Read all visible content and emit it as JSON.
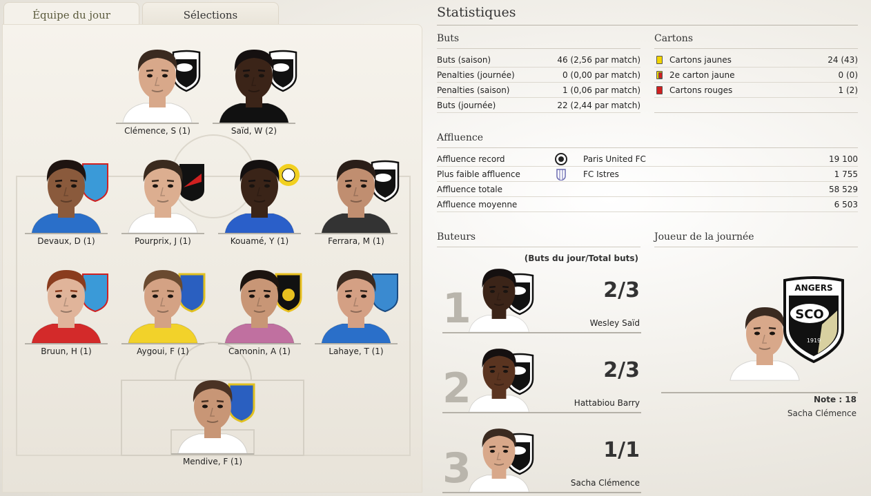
{
  "tabs": [
    {
      "label": "Équipe du jour",
      "active": true
    },
    {
      "label": "Sélections",
      "active": false
    }
  ],
  "team_of_day": {
    "players": [
      {
        "name": "Clémence, S (1)",
        "club": "SCO",
        "skin": "#d8a88a",
        "hair": "#3a2a20",
        "shirt": "#ffffff"
      },
      {
        "name": "Saïd, W (2)",
        "club": "SCO",
        "skin": "#3b2418",
        "hair": "#151010",
        "shirt": "#111111"
      },
      {
        "name": "Devaux, D (1)",
        "club": "VENDÉE",
        "skin": "#8a5a3c",
        "hair": "#1e1410",
        "shirt": "#2a6fc9"
      },
      {
        "name": "Pourprix, J (1)",
        "club": "RACING",
        "skin": "#dcae90",
        "hair": "#3a2a1e",
        "shirt": "#ffffff"
      },
      {
        "name": "Kouamé, Y (1)",
        "club": "SRC",
        "skin": "#3a2418",
        "hair": "#141010",
        "shirt": "#2a5fc9"
      },
      {
        "name": "Ferrara, M (1)",
        "club": "SCO",
        "skin": "#c08e70",
        "hair": "#2a1e18",
        "shirt": "#333333"
      },
      {
        "name": "Bruun, H (1)",
        "club": "VENDÉE",
        "skin": "#e0b49a",
        "hair": "#8a3c1e",
        "shirt": "#d32a2a"
      },
      {
        "name": "Aygoui, F (1)",
        "club": "UJ FC",
        "skin": "#d4a284",
        "hair": "#6a4a30",
        "shirt": "#f2d22a"
      },
      {
        "name": "Camonin, A (1)",
        "club": "TOUL",
        "skin": "#c89676",
        "hair": "#1c1410",
        "shirt": "#c070a0"
      },
      {
        "name": "Lahaye, T (1)",
        "club": "CHAMOIS",
        "skin": "#d4a084",
        "hair": "#3a2a20",
        "shirt": "#2a6fc9"
      },
      {
        "name": "Mendive, F (1)",
        "club": "UJ FC",
        "skin": "#c89676",
        "hair": "#4a3224",
        "shirt": "#ffffff"
      }
    ]
  },
  "stats": {
    "title": "Statistiques",
    "buts": {
      "title": "Buts",
      "rows": [
        {
          "label": "Buts (saison)",
          "value": "46 (2,56 par match)"
        },
        {
          "label": "Penalties (journée)",
          "value": "0 (0,00 par match)"
        },
        {
          "label": "Penalties (saison)",
          "value": "1 (0,06 par match)"
        },
        {
          "label": "Buts (journée)",
          "value": "22 (2,44 par match)"
        }
      ]
    },
    "cartons": {
      "title": "Cartons",
      "rows": [
        {
          "label": "Cartons jaunes",
          "value": "24 (43)",
          "color": "#f2d400"
        },
        {
          "label": "2e carton jaune",
          "value": "0 (0)",
          "color": "#f2d400"
        },
        {
          "label": "Cartons rouges",
          "value": "1 (2)",
          "color": "#d02020"
        }
      ]
    },
    "affluence": {
      "title": "Affluence",
      "rows": [
        {
          "label": "Affluence record",
          "club": "Paris United FC",
          "value": "19 100"
        },
        {
          "label": "Plus faible affluence",
          "club": "FC Istres",
          "value": "1 755"
        },
        {
          "label": "Affluence totale",
          "club": "",
          "value": "58 529"
        },
        {
          "label": "Affluence moyenne",
          "club": "",
          "value": "6 503"
        }
      ]
    }
  },
  "buteurs": {
    "title": "Buteurs",
    "header": "(Buts du jour/Total buts)",
    "list": [
      {
        "rank": "1",
        "goals": "2/3",
        "name": "Wesley Saïd",
        "club": "SCO",
        "skin": "#3b2418",
        "hair": "#151010"
      },
      {
        "rank": "2",
        "goals": "2/3",
        "name": "Hattabiou Barry",
        "club": "B",
        "skin": "#5a3420",
        "hair": "#151010"
      },
      {
        "rank": "3",
        "goals": "1/1",
        "name": "Sacha Clémence",
        "club": "SCO",
        "skin": "#d8a88a",
        "hair": "#3a2a20"
      }
    ]
  },
  "joueur_journee": {
    "title": "Joueur de la journée",
    "note": "Note : 18",
    "name": "Sacha Clémence",
    "crest_top": "ANGERS",
    "crest_mid": "SCO",
    "crest_year": "1919"
  }
}
